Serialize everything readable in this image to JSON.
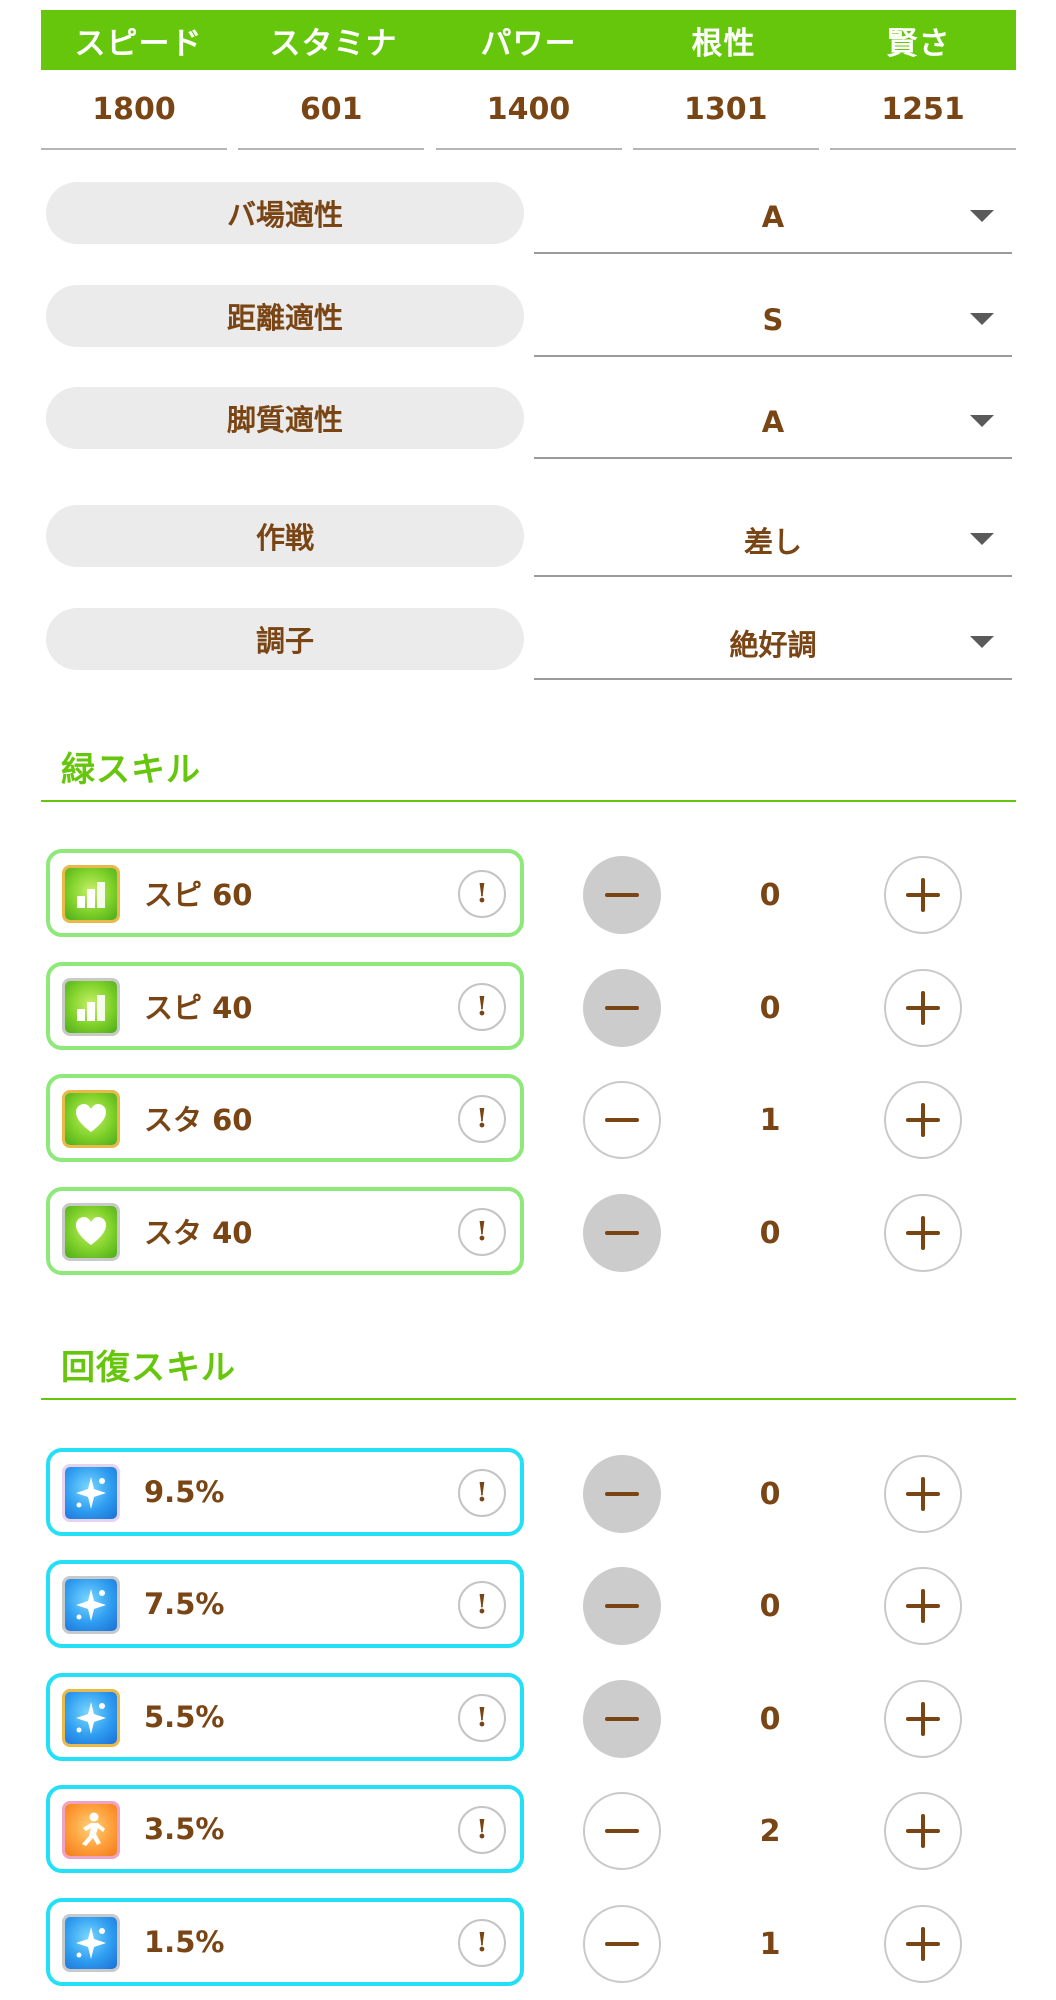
{
  "stats": {
    "headers": [
      "スピード",
      "スタミナ",
      "パワー",
      "根性",
      "賢さ"
    ],
    "values": [
      "1800",
      "601",
      "1400",
      "1301",
      "1251"
    ]
  },
  "settings": [
    {
      "label": "バ場適性",
      "value": "A"
    },
    {
      "label": "距離適性",
      "value": "S"
    },
    {
      "label": "脚質適性",
      "value": "A"
    },
    {
      "label": "作戦",
      "value": "差し"
    },
    {
      "label": "調子",
      "value": "絶好調"
    }
  ],
  "sections": {
    "green": {
      "title": "緑スキル",
      "skills": [
        {
          "name": "スピ 60",
          "count": "0",
          "icon": "speed-chart-icon",
          "minus_disabled": true
        },
        {
          "name": "スピ 40",
          "count": "0",
          "icon": "speed-chart-icon",
          "minus_disabled": true
        },
        {
          "name": "スタ 60",
          "count": "1",
          "icon": "heart-icon",
          "minus_disabled": false
        },
        {
          "name": "スタ 40",
          "count": "0",
          "icon": "heart-icon",
          "minus_disabled": true
        }
      ]
    },
    "recovery": {
      "title": "回復スキル",
      "skills": [
        {
          "name": "9.5%",
          "count": "0",
          "icon": "sparkle-icon",
          "minus_disabled": true
        },
        {
          "name": "7.5%",
          "count": "0",
          "icon": "sparkle-icon",
          "minus_disabled": true
        },
        {
          "name": "5.5%",
          "count": "0",
          "icon": "sparkle-icon",
          "minus_disabled": true
        },
        {
          "name": "3.5%",
          "count": "2",
          "icon": "runner-icon",
          "minus_disabled": false
        },
        {
          "name": "1.5%",
          "count": "1",
          "icon": "sparkle-icon",
          "minus_disabled": false
        }
      ]
    }
  },
  "info_glyph": "!",
  "colors": {
    "accent_green": "#66c60b",
    "text_brown": "#7a4514",
    "green_border": "#8ee87a",
    "cyan_border": "#24e0f6"
  }
}
